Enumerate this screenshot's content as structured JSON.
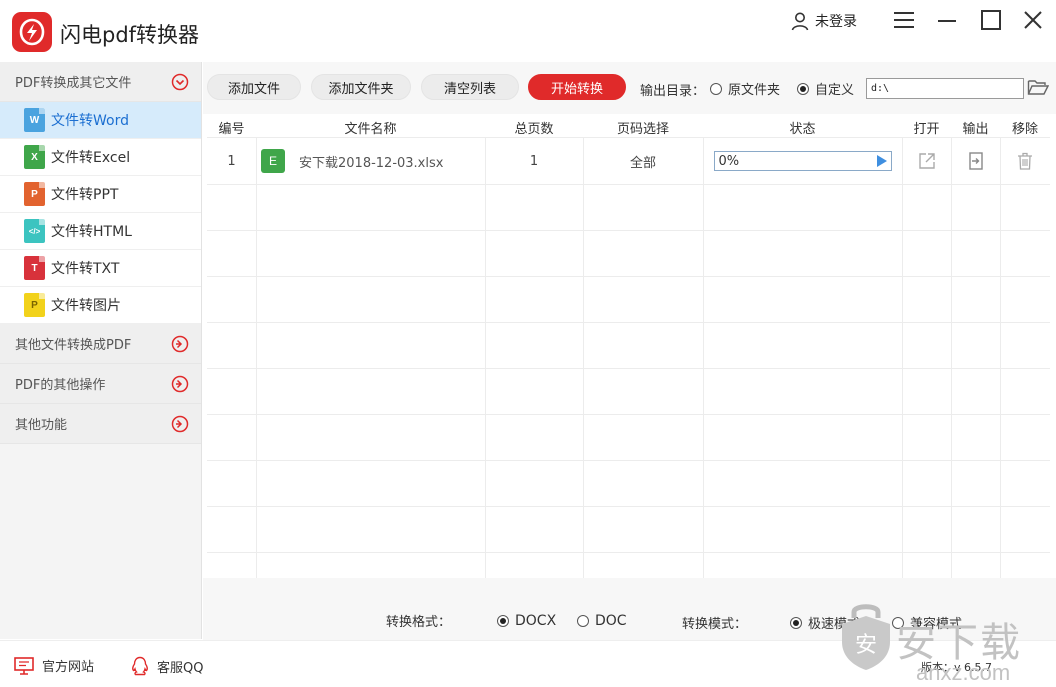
{
  "app": {
    "title": "闪电pdf转换器",
    "user_label": "未登录",
    "accent_color": "#e02a2a"
  },
  "sidebar": {
    "groups": [
      {
        "label": "PDF转换成其它文件",
        "expanded": true,
        "items": [
          {
            "label": "文件转Word",
            "icon": "W",
            "color": "#4aa3df",
            "active": true
          },
          {
            "label": "文件转Excel",
            "icon": "X",
            "color": "#3fa64a",
            "active": false
          },
          {
            "label": "文件转PPT",
            "icon": "P",
            "color": "#e2632f",
            "active": false
          },
          {
            "label": "文件转HTML",
            "icon": "</>",
            "color": "#3cc4c0",
            "active": false
          },
          {
            "label": "文件转TXT",
            "icon": "T",
            "color": "#d8323b",
            "active": false
          },
          {
            "label": "文件转图片",
            "icon": "P",
            "color": "#f2d21b",
            "active": false
          }
        ]
      },
      {
        "label": "其他文件转换成PDF",
        "expanded": false
      },
      {
        "label": "PDF的其他操作",
        "expanded": false
      },
      {
        "label": "其他功能",
        "expanded": false
      }
    ]
  },
  "toolbar": {
    "add_file": "添加文件",
    "add_folder": "添加文件夹",
    "clear_list": "清空列表",
    "start": "开始转换",
    "output_label": "输出目录：",
    "output_original": "原文件夹",
    "output_custom": "自定义",
    "output_path": "d:\\"
  },
  "table": {
    "headers": {
      "index": "编号",
      "name": "文件名称",
      "pages": "总页数",
      "range": "页码选择",
      "status": "状态",
      "open": "打开",
      "output": "输出",
      "remove": "移除"
    },
    "rows": [
      {
        "index": "1",
        "type_icon": "E",
        "name": "安下载2018-12-03.xlsx",
        "pages": "1",
        "range": "全部",
        "status": "0%"
      }
    ]
  },
  "options": {
    "format_label": "转换格式：",
    "format_docx": "DOCX",
    "format_doc": "DOC",
    "mode_label": "转换模式：",
    "mode_fast": "极速模式",
    "mode_compat": "兼容模式"
  },
  "footer": {
    "website": "官方网站",
    "qq": "客服QQ",
    "version": "版本：v 6.5.7"
  },
  "watermark": {
    "text": "安下载",
    "sub": "anxz.com"
  }
}
